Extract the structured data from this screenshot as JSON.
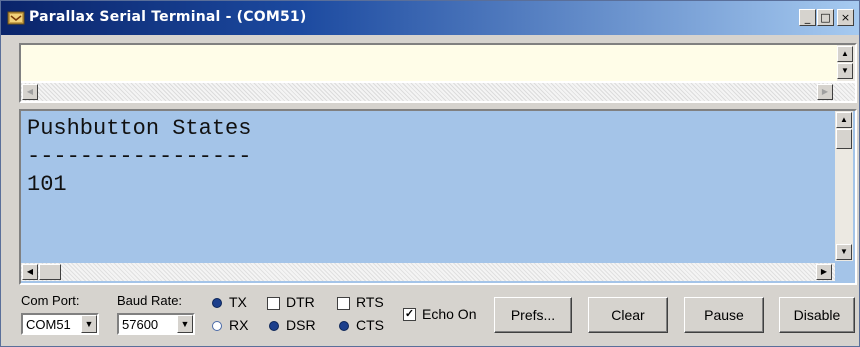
{
  "window": {
    "title": "Parallax Serial Terminal - (COM51)",
    "controls": {
      "minimize": "_",
      "maximize": "□",
      "close": "×"
    }
  },
  "input": {
    "value": "",
    "placeholder": ""
  },
  "output": {
    "lines": [
      "Pushbutton States",
      "-----------------",
      "101"
    ]
  },
  "bottom": {
    "com_port": {
      "label": "Com Port:",
      "value": "COM51"
    },
    "baud_rate": {
      "label": "Baud Rate:",
      "value": "57600"
    },
    "signals": {
      "tx": "TX",
      "rx": "RX",
      "dtr": "DTR",
      "rts": "RTS",
      "dsr": "DSR",
      "cts": "CTS"
    },
    "echo_on": {
      "label": "Echo On",
      "checked": true
    },
    "buttons": {
      "prefs": "Prefs...",
      "clear": "Clear",
      "pause": "Pause",
      "disable": "Disable"
    }
  },
  "colors": {
    "led_active": "#1c3f8c",
    "led_inactive": "#ffffff",
    "output_bg": "#a4c4e8",
    "input_bg": "#fffde8"
  }
}
